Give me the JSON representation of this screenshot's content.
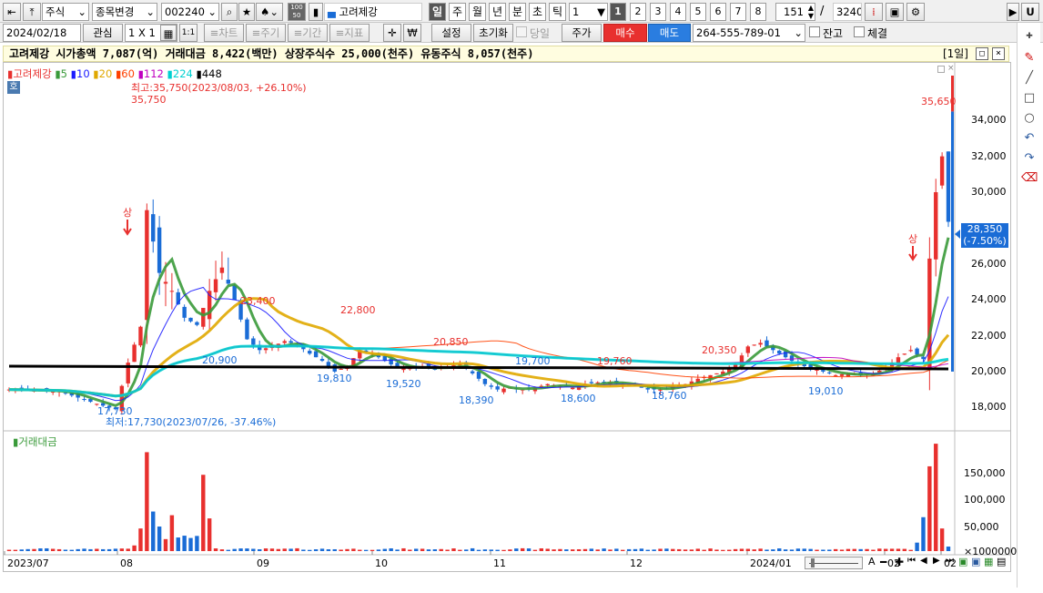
{
  "toolbar1": {
    "market": "주식",
    "search_mode": "종목변경",
    "code": "002240",
    "stock_name": "고려제강",
    "dropdown_lots": [
      "100",
      "50"
    ],
    "periods": [
      "일",
      "주",
      "월",
      "년",
      "분",
      "초",
      "틱"
    ],
    "active_period": "일",
    "interval": "1",
    "num_tabs": [
      "1",
      "2",
      "3",
      "4",
      "5",
      "6",
      "7",
      "8"
    ],
    "active_num": "1",
    "count": "151",
    "total": "3240",
    "u_label": "U"
  },
  "toolbar2": {
    "date": "2024/02/18",
    "watch": "관심",
    "grid": "1 X 1",
    "one_one": "1:1",
    "chart_btn": "≡차트",
    "cycle_btn": "≡주기",
    "period_btn": "≡기간",
    "indicator_btn": "≡지표",
    "settings": "설정",
    "reset": "초기화",
    "today": "당일",
    "price": "주가",
    "buy": "매수",
    "sell": "매도",
    "account": "264-555-789-01",
    "balance": "잔고",
    "fill": "체결"
  },
  "info_bar": {
    "text": "고려제강  시가총액 7,087(억)  거래대금 8,422(백만)  상장주식수 25,000(천주)  유동주식 8,057(천주)",
    "period_tag": "[1일]"
  },
  "legend": {
    "name": "고려제강",
    "ma": [
      {
        "label": "5",
        "color": "#3a9a3a"
      },
      {
        "label": "10",
        "color": "#1a1aff"
      },
      {
        "label": "20",
        "color": "#e0a800"
      },
      {
        "label": "60",
        "color": "#ff4000"
      },
      {
        "label": "112",
        "color": "#c000c0"
      },
      {
        "label": "224",
        "color": "#00d0d0"
      },
      {
        "label": "448",
        "color": "#000000"
      }
    ],
    "ho": "호"
  },
  "annotations": {
    "high_label": "최고:35,750(2023/08/03, +26.10%)",
    "low_label": "최저:17,730(2023/07/26, -37.46%)",
    "points": [
      "35,750",
      "23,400",
      "22,800",
      "20,850",
      "20,900",
      "19,810",
      "19,520",
      "18,390",
      "19,700",
      "18,600",
      "19,760",
      "18,760",
      "20,350",
      "19,010",
      "17,730",
      "35,650"
    ],
    "upper_limit": "상"
  },
  "price_axis": [
    "34,000",
    "32,000",
    "30,000",
    "28,000",
    "26,000",
    "24,000",
    "22,000",
    "20,000",
    "18,000"
  ],
  "current_price": {
    "price": "28,350",
    "change": "(-7.50%)"
  },
  "volume": {
    "title": "거래대금",
    "axis": [
      "150,000",
      "100,000",
      "50,000",
      "×1000000"
    ]
  },
  "x_axis": [
    "2023/07",
    "08",
    "09",
    "10",
    "11",
    "12",
    "2024/01",
    "02",
    "02"
  ],
  "colors": {
    "up": "#e8302e",
    "down": "#1a6cd6",
    "buy": "#e8302e",
    "sell": "#2a7de0"
  },
  "chart_data": {
    "type": "candlestick",
    "symbol": "고려제강",
    "period": "1일",
    "y_range": [
      17000,
      36500
    ],
    "high": {
      "value": 35750,
      "date": "2023/08/03",
      "pct": 26.1
    },
    "low": {
      "value": 17730,
      "date": "2023/07/26",
      "pct": -37.46
    },
    "last_price": 28350,
    "last_change_pct": -7.5,
    "series": [
      {
        "name": "448",
        "values": [
          20150,
          20150
        ]
      }
    ]
  }
}
